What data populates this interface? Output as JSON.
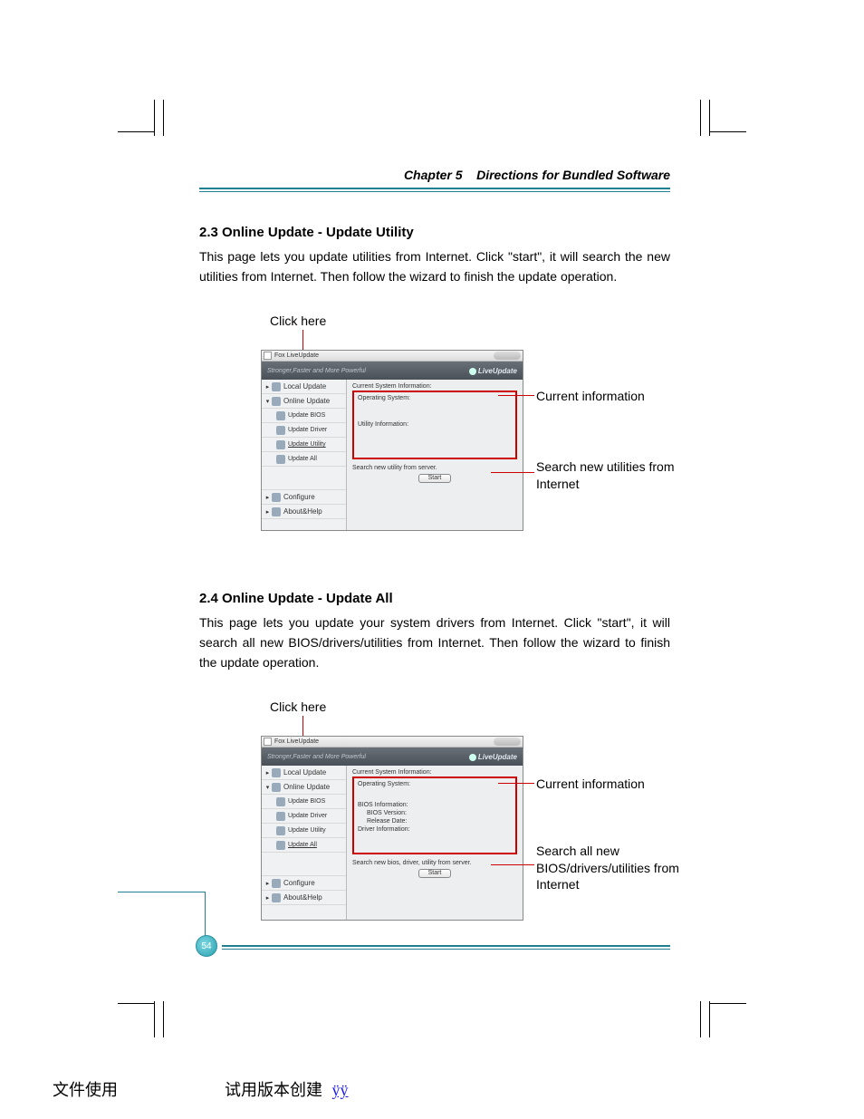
{
  "header": {
    "chapter": "Chapter 5",
    "title": "Directions for Bundled Software"
  },
  "section1": {
    "heading": "2.3 Online Update - Update Utility",
    "body": "This page lets you update utilities from Internet. Click \"start\", it will search the new utilities from Internet. Then follow the wizard to finish the update operation.",
    "click_label": "Click here",
    "callout_info": "Current information",
    "callout_search": "Search new utilities from Internet"
  },
  "section2": {
    "heading": "2.4 Online Update - Update All",
    "body": "This page lets you update your system drivers from Internet. Click \"start\", it will search all new BIOS/drivers/utilities from Internet. Then follow the wizard to finish the update operation.",
    "click_label": "Click here",
    "callout_info": "Current information",
    "callout_search": "Search all new BIOS/drivers/utilities from Internet"
  },
  "app": {
    "title": "Fox LiveUpdate",
    "banner_left": "Stronger,Faster and More Powerful",
    "banner_right": "LiveUpdate",
    "sidebar": {
      "local": "Local Update",
      "online": "Online Update",
      "bios": "Update BIOS",
      "driver": "Update Driver",
      "utility": "Update Utility",
      "all": "Update All",
      "configure": "Configure",
      "about": "About&Help"
    },
    "pane1": {
      "curinfo": "Current System Information:",
      "os": "Operating System:",
      "util": "Utility Information:",
      "search": "Search new utility from server.",
      "start": "Start"
    },
    "pane2": {
      "curinfo": "Current System Information:",
      "os": "Operating System:",
      "biosinfo": "BIOS Information:",
      "biosver": "BIOS Version:",
      "reldate": "Release Date:",
      "drvinfo": "Driver Information:",
      "search": "Search new bios, driver, utility from server.",
      "start": "Start"
    }
  },
  "page_number": "54",
  "footer": {
    "left": "文件使用",
    "mid": "试用版本创建",
    "link": "ÿÿ"
  }
}
